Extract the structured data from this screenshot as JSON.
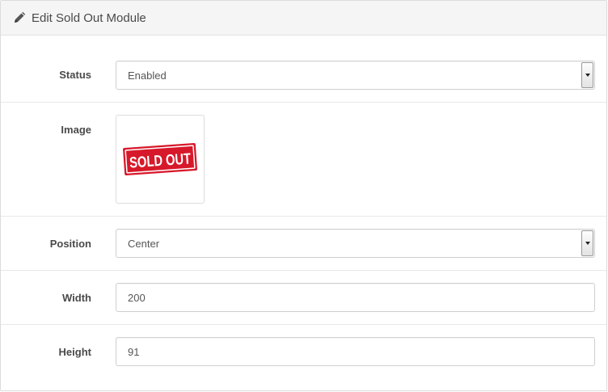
{
  "header": {
    "title": "Edit Sold Out Module",
    "icon": "pencil-icon"
  },
  "form": {
    "status": {
      "label": "Status",
      "value": "Enabled"
    },
    "image": {
      "label": "Image",
      "stamp_text": "SOLD OUT",
      "stamp_color": "#d7182a"
    },
    "position": {
      "label": "Position",
      "value": "Center"
    },
    "width": {
      "label": "Width",
      "value": "200"
    },
    "height": {
      "label": "Height",
      "value": "91"
    }
  }
}
